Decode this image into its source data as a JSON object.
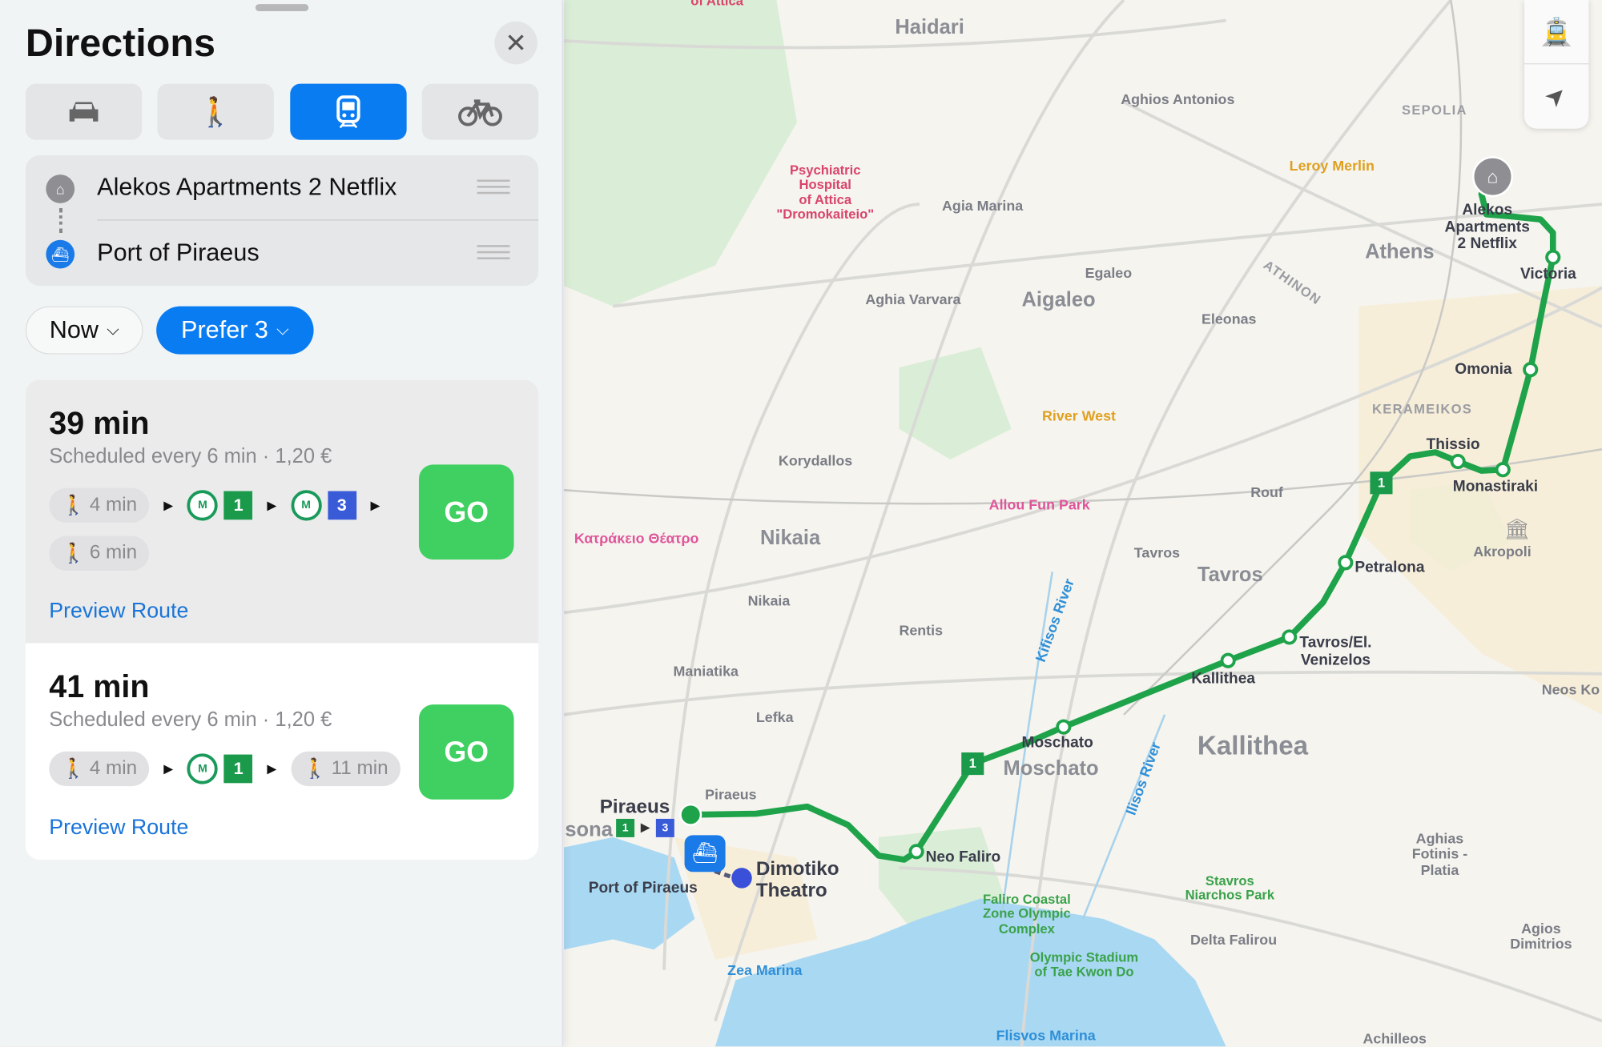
{
  "panel": {
    "title": "Directions",
    "close_icon": "xmark-icon",
    "modes": [
      {
        "name": "drive",
        "icon": "car-icon",
        "active": false
      },
      {
        "name": "walk",
        "icon": "walk-icon",
        "active": false
      },
      {
        "name": "transit",
        "icon": "tram-icon",
        "active": true
      },
      {
        "name": "cycle",
        "icon": "bicycle-icon",
        "active": false
      }
    ],
    "origin": "Alekos Apartments 2 Netflix",
    "destination": "Port of Piraeus",
    "time_option": "Now",
    "prefer_option": "Prefer 3",
    "accent_color": "#0a7cf2",
    "go_color": "#3fd061",
    "routes": [
      {
        "duration": "39 min",
        "details": "Scheduled every 6 min · 1,20 €",
        "walk1": "4 min",
        "line1": "1",
        "line2": "3",
        "walk2": "6 min",
        "go": "GO",
        "preview": "Preview Route"
      },
      {
        "duration": "41 min",
        "details": "Scheduled every 6 min · 1,20 €",
        "walk1": "4 min",
        "line1": "1",
        "walk2": "11 min",
        "go": "GO",
        "preview": "Preview Route"
      }
    ],
    "line_colors": {
      "1": "#1a9a4a",
      "3": "#3a5bd8"
    }
  },
  "map": {
    "route_color": "#1fa34a",
    "controls": [
      "tram-icon",
      "location-arrow-icon"
    ],
    "route_badges": [
      "1",
      "1",
      "1",
      "3"
    ],
    "labels": [
      "of Attica",
      "Haidari",
      "Aghios Antonios",
      "SEPOLIA",
      "Leroy Merlin",
      "Psychiatric\nHospital\nof Attica\n\"Dromokaiteio\"",
      "Agia Marina",
      "Athens",
      "Alekos\nApartments\n2 Netflix",
      "Victoria",
      "Egaleo",
      "Aigaleo",
      "Aghia Varvara",
      "ATHINON",
      "Eleonas",
      "Omonia",
      "River West",
      "KERAMEIKOS",
      "Thissio",
      "Korydallos",
      "Monastiraki",
      "Rouf",
      "Allou Fun Park",
      "Κατράκειο Θέατρο",
      "Nikaia",
      "Akropoli",
      "Tavros",
      "Tavros",
      "Petralona",
      "Nikaia",
      "Rentis",
      "Kifisos River",
      "Tavros/El.\nVenizelos",
      "Maniatika",
      "Kallithea",
      "Neos Ko",
      "Lefka",
      "Moschato",
      "Kallithea",
      "Moschato",
      "Ilisos River",
      "Piraeus",
      "Piraeus",
      "sona",
      "Aghias\nFotinis -\nPlatia",
      "Neo Faliro",
      "Dimotiko\nTheatro",
      "Stavros\nNiarchos Park",
      "Port of Piraeus",
      "Faliro Coastal\nZone Olympic\nComplex",
      "Agios\nDimitrios",
      "Delta Falirou",
      "Olympic Stadium\nof Tae Kwon Do",
      "Zea Marina",
      "Flisvos Marina",
      "Achilleos"
    ]
  }
}
